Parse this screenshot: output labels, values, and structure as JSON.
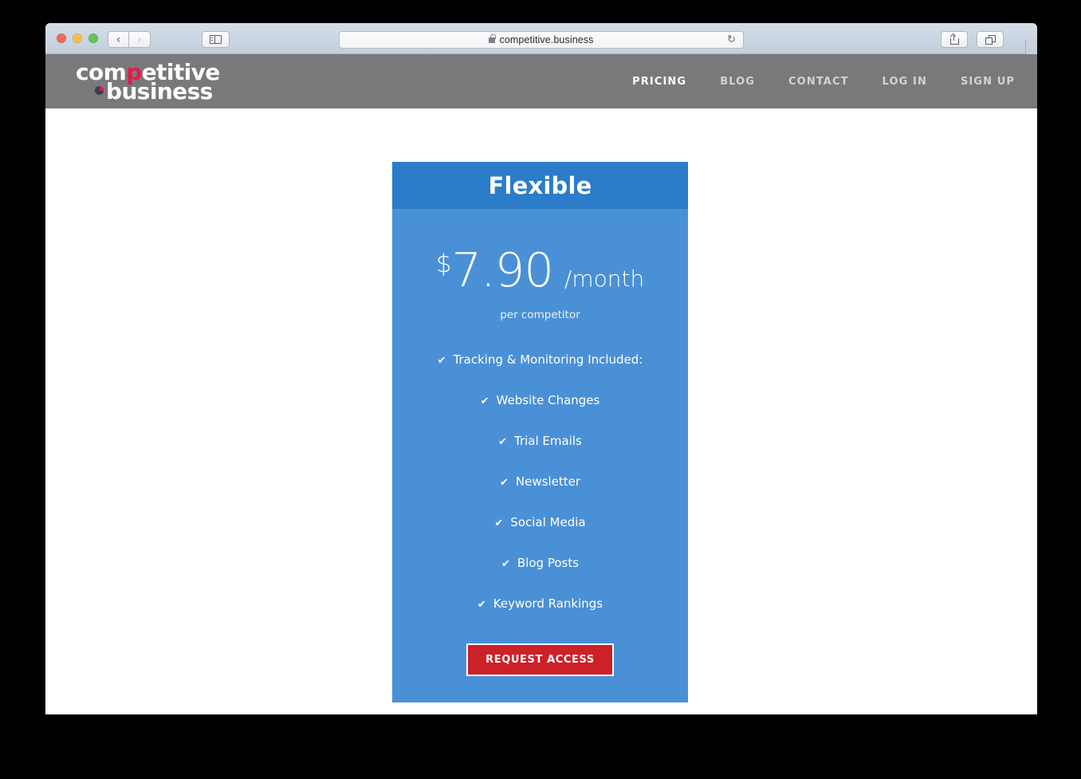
{
  "browser": {
    "url": "competitive.business",
    "secure_icon": "lock-icon",
    "reload_icon": "reload-icon",
    "back_icon": "chevron-left-icon",
    "forward_icon": "chevron-right-icon",
    "sidebar_icon": "sidebar-toggle-icon",
    "share_icon": "share-icon",
    "tabs_icon": "show-tabs-icon",
    "new_tab_icon": "plus-icon"
  },
  "site": {
    "logo": {
      "line1_pre": "com",
      "line1_accent": "p",
      "line1_post": "etitive",
      "line2": "business"
    },
    "nav": [
      {
        "label": "PRICING",
        "active": true
      },
      {
        "label": "BLOG",
        "active": false
      },
      {
        "label": "CONTACT",
        "active": false
      },
      {
        "label": "LOG IN",
        "active": false
      },
      {
        "label": "SIGN UP",
        "active": false
      }
    ]
  },
  "pricing_card": {
    "title": "Flexible",
    "currency": "$",
    "amount": "7.90",
    "period": "/month",
    "per_unit": "per competitor",
    "features": [
      "Tracking & Monitoring Included:",
      "Website Changes",
      "Trial Emails",
      "Newsletter",
      "Social Media",
      "Blog Posts",
      "Keyword Rankings"
    ],
    "check_glyph": "✔",
    "cta_label": "REQUEST ACCESS"
  },
  "colors": {
    "card_header": "#2b7cc9",
    "card_body": "#4a90d6",
    "cta": "#cc2128",
    "nav_bar": "#78797b",
    "logo_accent": "#e8174a"
  }
}
